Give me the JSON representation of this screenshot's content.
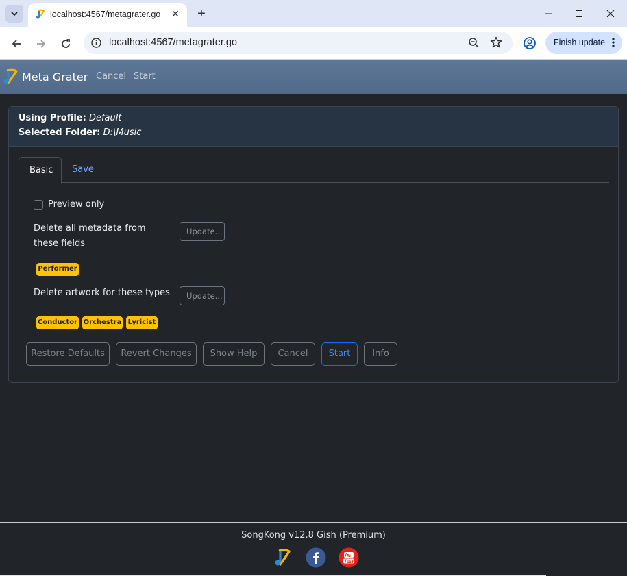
{
  "browser": {
    "tab_title": "localhost:4567/metagrater.go",
    "url": "localhost:4567/metagrater.go",
    "update_button": "Finish update"
  },
  "app": {
    "brand": "Meta Grater",
    "nav": [
      "Cancel",
      "Start"
    ]
  },
  "card": {
    "profile_label": "Using Profile:",
    "profile_value": "Default",
    "folder_label": "Selected Folder:",
    "folder_value": "D:\\Music",
    "tabs": [
      "Basic",
      "Save"
    ],
    "preview_label": "Preview only",
    "preview_checked": false,
    "delete_metadata_label": "Delete all metadata from these fields",
    "delete_metadata_button": "Update...",
    "metadata_fields": [
      "Performer"
    ],
    "delete_artwork_label": "Delete artwork for these types",
    "delete_artwork_button": "Update...",
    "artwork_types": [
      "Conductor",
      "Orchestra",
      "Lyricist"
    ],
    "actions": [
      "Restore Defaults",
      "Revert Changes",
      "Show Help",
      "Cancel",
      "Start",
      "Info"
    ]
  },
  "footer": {
    "version": "SongKong v12.8 Gish (Premium)"
  },
  "colors": {
    "background": "#212529",
    "navbar": "#5a7292",
    "badge": "#ffc107",
    "primary": "#0d6efd",
    "link": "#6ea8fe"
  }
}
